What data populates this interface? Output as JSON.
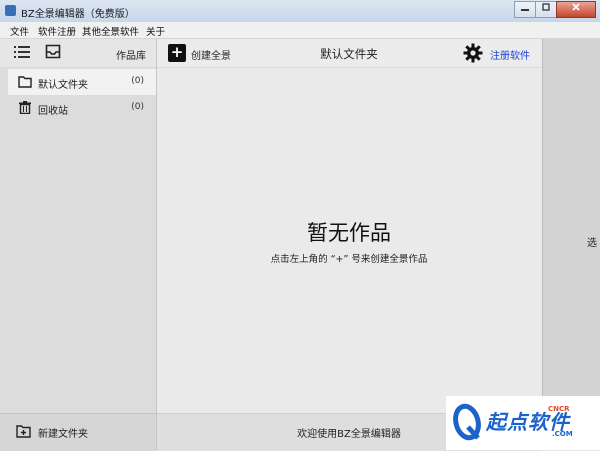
{
  "window": {
    "title": "BZ全景编辑器（免费版）"
  },
  "menu": {
    "items": [
      "文件",
      "软件注册",
      "其他全景软件",
      "关于"
    ]
  },
  "sidebar": {
    "library_label": "作品库",
    "folders": [
      {
        "name": "默认文件夹",
        "count": "(0)",
        "icon": "folder-icon",
        "selected": true
      },
      {
        "name": "回收站",
        "count": "(0)",
        "icon": "trash-icon",
        "selected": false
      }
    ],
    "new_folder_label": "新建文件夹"
  },
  "main": {
    "create_label": "创建全景",
    "plus_symbol": "+",
    "folder_title": "默认文件夹",
    "register_label": "注册软件",
    "empty_title": "暂无作品",
    "empty_hint": "点击左上角的 “+” 号来创建全景作品",
    "welcome": "欢迎使用BZ全景编辑器"
  },
  "right_panel": {
    "partial_text": "选"
  },
  "watermark": {
    "text": "起点软件",
    "sub_top": "CNCR",
    "sub_bottom": ".COM"
  },
  "colors": {
    "link": "#1a3fd6",
    "sidebar_bg": "#dcdcdc",
    "main_bg": "#eaeaea",
    "watermark_blue": "#1c63c9"
  }
}
